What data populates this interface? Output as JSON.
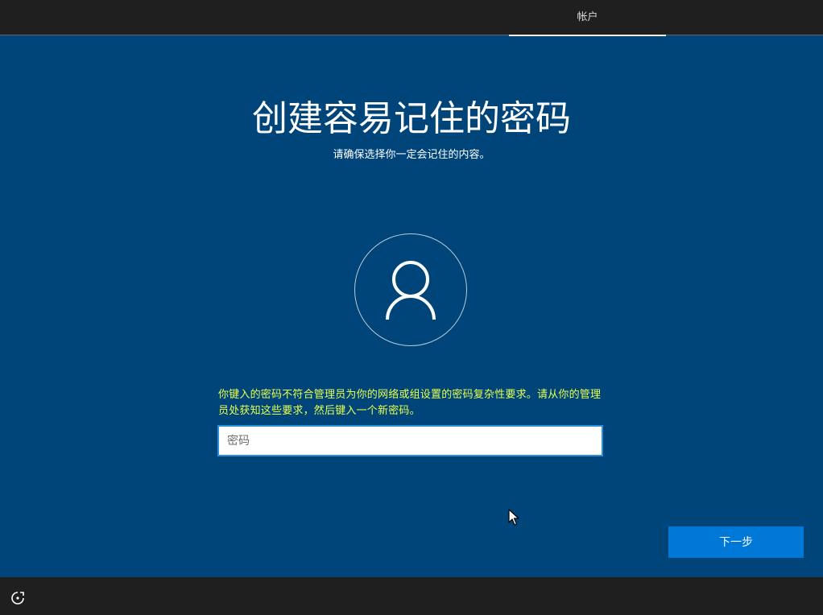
{
  "header": {
    "tab_label": "帐户"
  },
  "main": {
    "title": "创建容易记住的密码",
    "subtitle": "请确保选择你一定会记住的内容。",
    "avatar_icon": "user-icon",
    "error_message": "你键入的密码不符合管理员为你的网络或组设置的密码复杂性要求。请从你的管理员处获知这些要求，然后键入一个新密码。",
    "password_field": {
      "value": "",
      "placeholder": "密码"
    },
    "next_label": "下一步"
  },
  "footer": {
    "accessibility_icon": "accessibility-icon"
  },
  "colors": {
    "background": "#00457a",
    "bar": "#1f1f1f",
    "accent": "#0078d7",
    "warning_text": "#e6ff4e"
  }
}
